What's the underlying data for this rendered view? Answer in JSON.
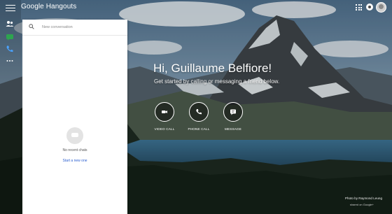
{
  "colors": {
    "sky": "#6f8fa6",
    "mountain": "#3d4346",
    "forest": "#1f2a21",
    "lake": "#2c5c78",
    "link": "#2b5fd0",
    "panel": "#ffffff"
  },
  "header": {
    "app_title": "Google Hangouts",
    "menu_icon": "menu-icon",
    "apps_icon": "apps-grid-icon",
    "status_icon": "status-icon",
    "avatar_icon": "avatar"
  },
  "rail": {
    "items": [
      {
        "icon": "contacts-icon"
      },
      {
        "icon": "chat-icon"
      },
      {
        "icon": "phone-icon"
      },
      {
        "icon": "more-icon"
      }
    ]
  },
  "conversations": {
    "search_placeholder": "New conversation",
    "empty_title": "No recent chats",
    "empty_link": "Start a new one"
  },
  "main": {
    "greeting": "Hi, Guillaume Belfiore!",
    "subtitle": "Get started by calling or messaging a friend below.",
    "actions": [
      {
        "label": "VIDEO CALL",
        "icon": "video-icon"
      },
      {
        "label": "PHONE CALL",
        "icon": "phone-icon"
      },
      {
        "label": "MESSAGE",
        "icon": "message-icon"
      }
    ]
  },
  "credit": {
    "photo_by": "Photo by Raymond Leung",
    "shared_on": "shared on Google+"
  }
}
